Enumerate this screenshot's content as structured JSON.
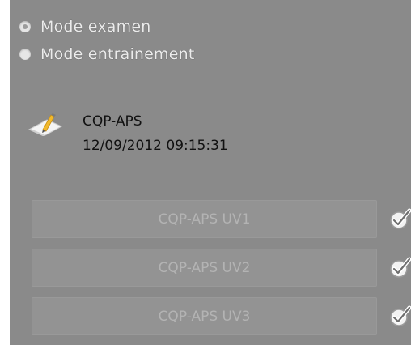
{
  "mode_options": [
    {
      "label": "Mode examen",
      "selected": true
    },
    {
      "label": "Mode entrainement",
      "selected": false
    }
  ],
  "session": {
    "icon": "edit-pencil-icon",
    "name": "CQP-APS",
    "datetime": "12/09/2012 09:15:31"
  },
  "units": [
    {
      "label": "CQP-APS UV1",
      "status_icon": "checkmark-circle-icon"
    },
    {
      "label": "CQP-APS UV2",
      "status_icon": "checkmark-circle-icon"
    },
    {
      "label": "CQP-APS UV3",
      "status_icon": "checkmark-circle-icon"
    }
  ],
  "colors": {
    "panel_background": "#8a8a8a",
    "button_background": "#939393",
    "button_text": "#b3b3b3",
    "session_text": "#111111"
  }
}
